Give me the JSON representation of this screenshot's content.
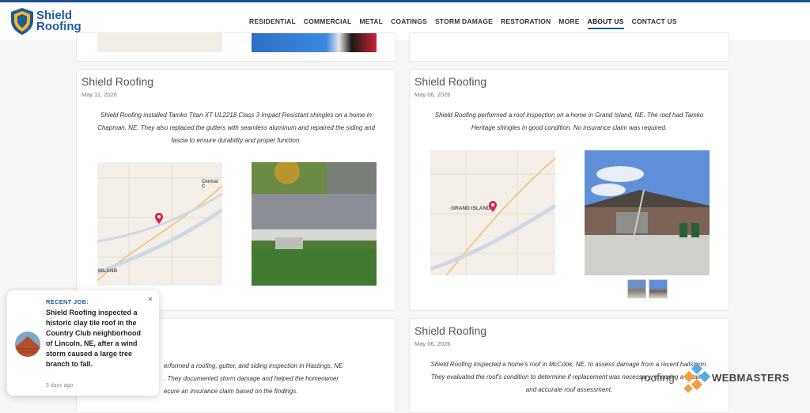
{
  "brand": {
    "name_line1": "Shield",
    "name_line2": "Roofing"
  },
  "nav": {
    "items": [
      "RESIDENTIAL",
      "COMMERCIAL",
      "METAL",
      "COATINGS",
      "STORM DAMAGE",
      "RESTORATION",
      "MORE",
      "ABOUT US",
      "CONTACT US"
    ],
    "active": "ABOUT US"
  },
  "cards": [
    {
      "title": "Shield Roofing",
      "date": "May 11, 2026",
      "description": "Shield Roofing installed Tamko Titan XT UL2218 Class 3 Impact Resistant shingles on a home in Chapman, NE. They also replaced the gutters with seamless aluminum and repaired the siding and fascia to ensure durability and proper function.",
      "map_labels": [
        "Central C",
        "ISLAND"
      ]
    },
    {
      "title": "Shield Roofing",
      "date": "May 06, 2026",
      "description": "Shield Roofing performed a roof inspection on a home in Grand Island, NE. The roof had Tamko Heritage shingles in good condition. No insurance claim was required.",
      "map_labels": [
        "GRAND ISLAND"
      ]
    },
    {
      "title": "Shield Roofing",
      "date": "May 06, 2026",
      "description": "Shield Roofing inspected a home's roof in McCook, NE, to assess damage from a recent hailstorm. They evaluated the roof's condition to determine if replacement was necessary, ensuring a detailed and accurate roof assessment."
    },
    {
      "description": "Shield Roofing performed a roofing, gutter, and siding inspection in Hastings, NE. They documented storm damage and helped the homeowner secure an insurance claim based on the findings.",
      "visible_fragments": [
        "erformed a roofing, gutter, and siding inspection in Hastings, NE",
        ". They documented storm damage and helped the homeowner",
        "ecure an insurance claim based on the findings."
      ]
    }
  ],
  "popup": {
    "label": "RECENT JOB:",
    "message": "Shield Roofing inspected a historic clay tile roof in the Country Club neighborhood of Lincoln, NE, after a wind storm caused a large tree branch to fall.",
    "ago": "5 days ago",
    "close": "×"
  },
  "badge": {
    "part1": "roofing",
    "part2": "WEBMASTERS"
  },
  "colors": {
    "brand_blue": "#1d5a9e",
    "pin_red": "#d9254a",
    "badge_orange": "#f39c3a",
    "badge_blue": "#5aa9e0"
  }
}
